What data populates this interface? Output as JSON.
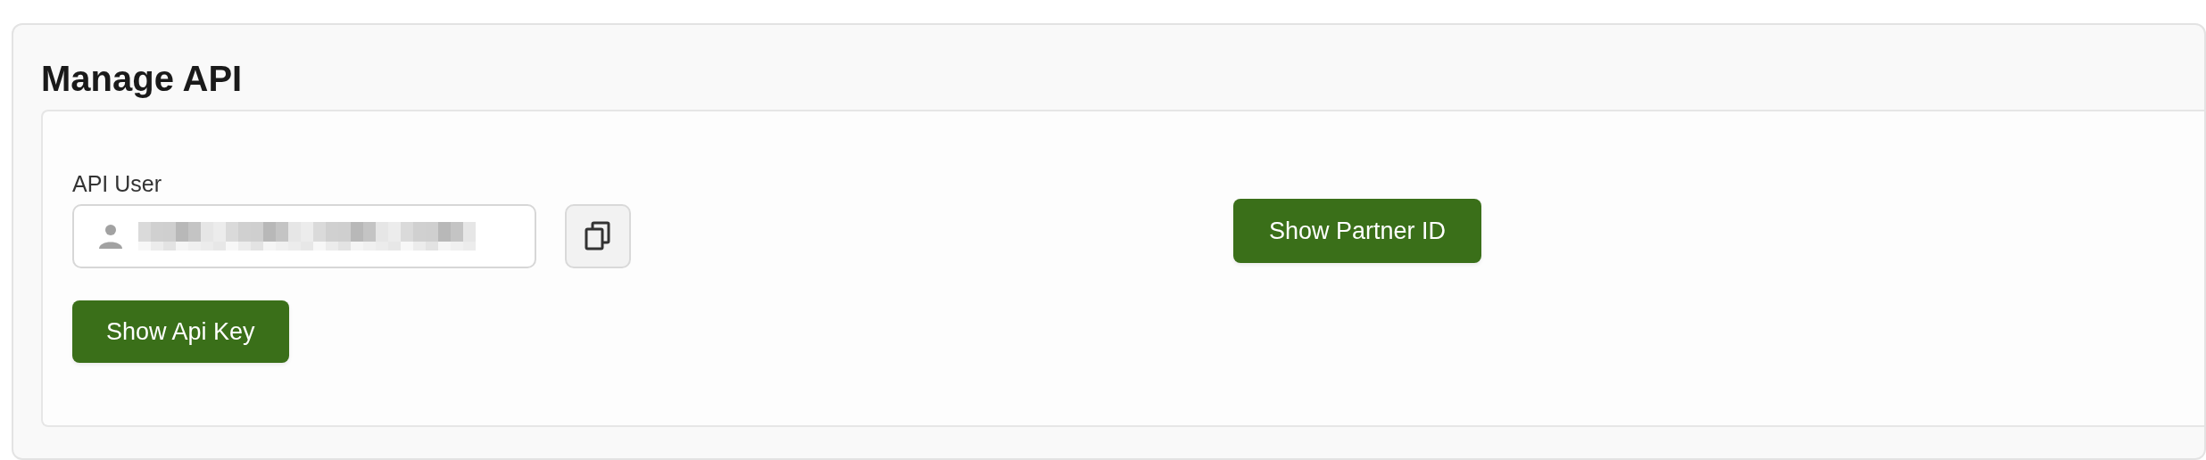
{
  "panel": {
    "title": "Manage API"
  },
  "api_user": {
    "label": "API User",
    "value_redacted": true
  },
  "buttons": [
    {
      "kind": "api_key",
      "label": "Show Api Key"
    },
    {
      "kind": "partner_id",
      "label": "Show Partner ID"
    }
  ]
}
